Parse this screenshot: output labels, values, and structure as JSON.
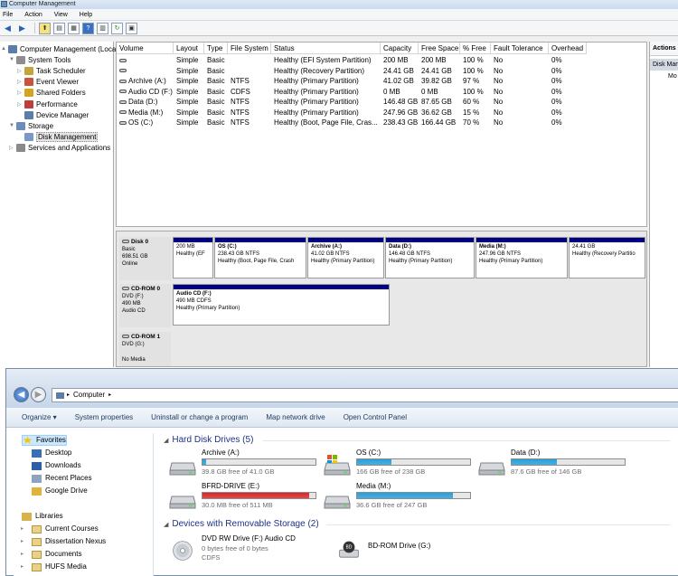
{
  "cm": {
    "title": "Computer Management",
    "menu": [
      "File",
      "Action",
      "View",
      "Help"
    ],
    "tree": [
      {
        "label": "Computer Management (Local",
        "indent": 0,
        "arrow": "▲"
      },
      {
        "label": "System Tools",
        "indent": 1,
        "arrow": "▼"
      },
      {
        "label": "Task Scheduler",
        "indent": 2,
        "arrow": "▷"
      },
      {
        "label": "Event Viewer",
        "indent": 2,
        "arrow": "▷"
      },
      {
        "label": "Shared Folders",
        "indent": 2,
        "arrow": "▷"
      },
      {
        "label": "Performance",
        "indent": 2,
        "arrow": "▷"
      },
      {
        "label": "Device Manager",
        "indent": 2,
        "arrow": ""
      },
      {
        "label": "Storage",
        "indent": 1,
        "arrow": "▼"
      },
      {
        "label": "Disk Management",
        "indent": 2,
        "arrow": "",
        "selected": true
      },
      {
        "label": "Services and Applications",
        "indent": 1,
        "arrow": "▷"
      }
    ],
    "columns": [
      "Volume",
      "Layout",
      "Type",
      "File System",
      "Status",
      "Capacity",
      "Free Space",
      "% Free",
      "Fault Tolerance",
      "Overhead"
    ],
    "volumes": [
      [
        "",
        "Simple",
        "Basic",
        "",
        "Healthy (EFI System Partition)",
        "200 MB",
        "200 MB",
        "100 %",
        "No",
        "0%"
      ],
      [
        "",
        "Simple",
        "Basic",
        "",
        "Healthy (Recovery Partition)",
        "24.41 GB",
        "24.41 GB",
        "100 %",
        "No",
        "0%"
      ],
      [
        "Archive (A:)",
        "Simple",
        "Basic",
        "NTFS",
        "Healthy (Primary Partition)",
        "41.02 GB",
        "39.82 GB",
        "97 %",
        "No",
        "0%"
      ],
      [
        "Audio CD (F:)",
        "Simple",
        "Basic",
        "CDFS",
        "Healthy (Primary Partition)",
        "0 MB",
        "0 MB",
        "100 %",
        "No",
        "0%"
      ],
      [
        "Data (D:)",
        "Simple",
        "Basic",
        "NTFS",
        "Healthy (Primary Partition)",
        "146.48 GB",
        "87.65 GB",
        "60 %",
        "No",
        "0%"
      ],
      [
        "Media (M:)",
        "Simple",
        "Basic",
        "NTFS",
        "Healthy (Primary Partition)",
        "247.96 GB",
        "36.62 GB",
        "15 %",
        "No",
        "0%"
      ],
      [
        "OS (C:)",
        "Simple",
        "Basic",
        "NTFS",
        "Healthy (Boot, Page File, Cras...",
        "238.43 GB",
        "166.44 GB",
        "70 %",
        "No",
        "0%"
      ]
    ],
    "disk0": {
      "name": "Disk 0",
      "type": "Basic",
      "size": "698.51 GB",
      "status": "Online"
    },
    "partitions": [
      {
        "name": "",
        "size": "200 MB",
        "status": "Healthy (EF"
      },
      {
        "name": "OS  (C:)",
        "size": "238.43 GB NTFS",
        "status": "Healthy (Boot, Page File, Crash"
      },
      {
        "name": "Archive  (A:)",
        "size": "41.02 GB NTFS",
        "status": "Healthy (Primary Partition)"
      },
      {
        "name": "Data  (D:)",
        "size": "146.48 GB NTFS",
        "status": "Healthy (Primary Partition)"
      },
      {
        "name": "Media  (M:)",
        "size": "247.96 GB NTFS",
        "status": "Healthy (Primary Partition)"
      },
      {
        "name": "",
        "size": "24.41 GB",
        "status": "Healthy (Recovery Partitio"
      }
    ],
    "cdrom0": {
      "name": "CD-ROM 0",
      "type": "DVD (F:)",
      "size": "490 MB",
      "status": "Audio CD"
    },
    "cdpart": {
      "name": "Audio CD  (F:)",
      "size": "490 MB CDFS",
      "status": "Healthy (Primary Partition)"
    },
    "cdrom1": {
      "name": "CD-ROM 1",
      "type": "DVD (G:)",
      "status": "No Media"
    },
    "actions": {
      "header": "Actions",
      "section": "Disk Mana",
      "more": "Mo"
    }
  },
  "ex": {
    "address": "Computer",
    "commands": [
      "Organize ▾",
      "System properties",
      "Uninstall or change a program",
      "Map network drive",
      "Open Control Panel"
    ],
    "nav": {
      "favorites": "Favorites",
      "fav_items": [
        "Desktop",
        "Downloads",
        "Recent Places",
        "Google Drive"
      ],
      "libraries": "Libraries",
      "lib_items": [
        "Current Courses",
        "Dissertation Nexus",
        "Documents",
        "HUFS Media"
      ]
    },
    "hdd_group": "Hard Disk Drives (5)",
    "removable_group": "Devices with Removable Storage (2)",
    "drives": [
      {
        "name": "Archive (A:)",
        "free": "39.8 GB free of 41.0 GB",
        "used": 0.03,
        "color": "#26a0da"
      },
      {
        "name": "OS (C:)",
        "free": "166 GB free of 238 GB",
        "used": 0.3,
        "color": "#26a0da"
      },
      {
        "name": "Data (D:)",
        "free": "87.6 GB free of 146 GB",
        "used": 0.4,
        "color": "#26a0da"
      },
      {
        "name": "BFRD-DRIVE (E:)",
        "free": "30.0 MB free of 511 MB",
        "used": 0.94,
        "color": "#da2626"
      },
      {
        "name": "Media (M:)",
        "free": "36.6 GB free of 247 GB",
        "used": 0.85,
        "color": "#26a0da"
      }
    ],
    "dvd": {
      "name": "DVD RW Drive (F:) Audio CD",
      "free": "0 bytes free of 0 bytes",
      "fs": "CDFS"
    },
    "bd": {
      "name": "BD-ROM Drive (G:)"
    }
  }
}
